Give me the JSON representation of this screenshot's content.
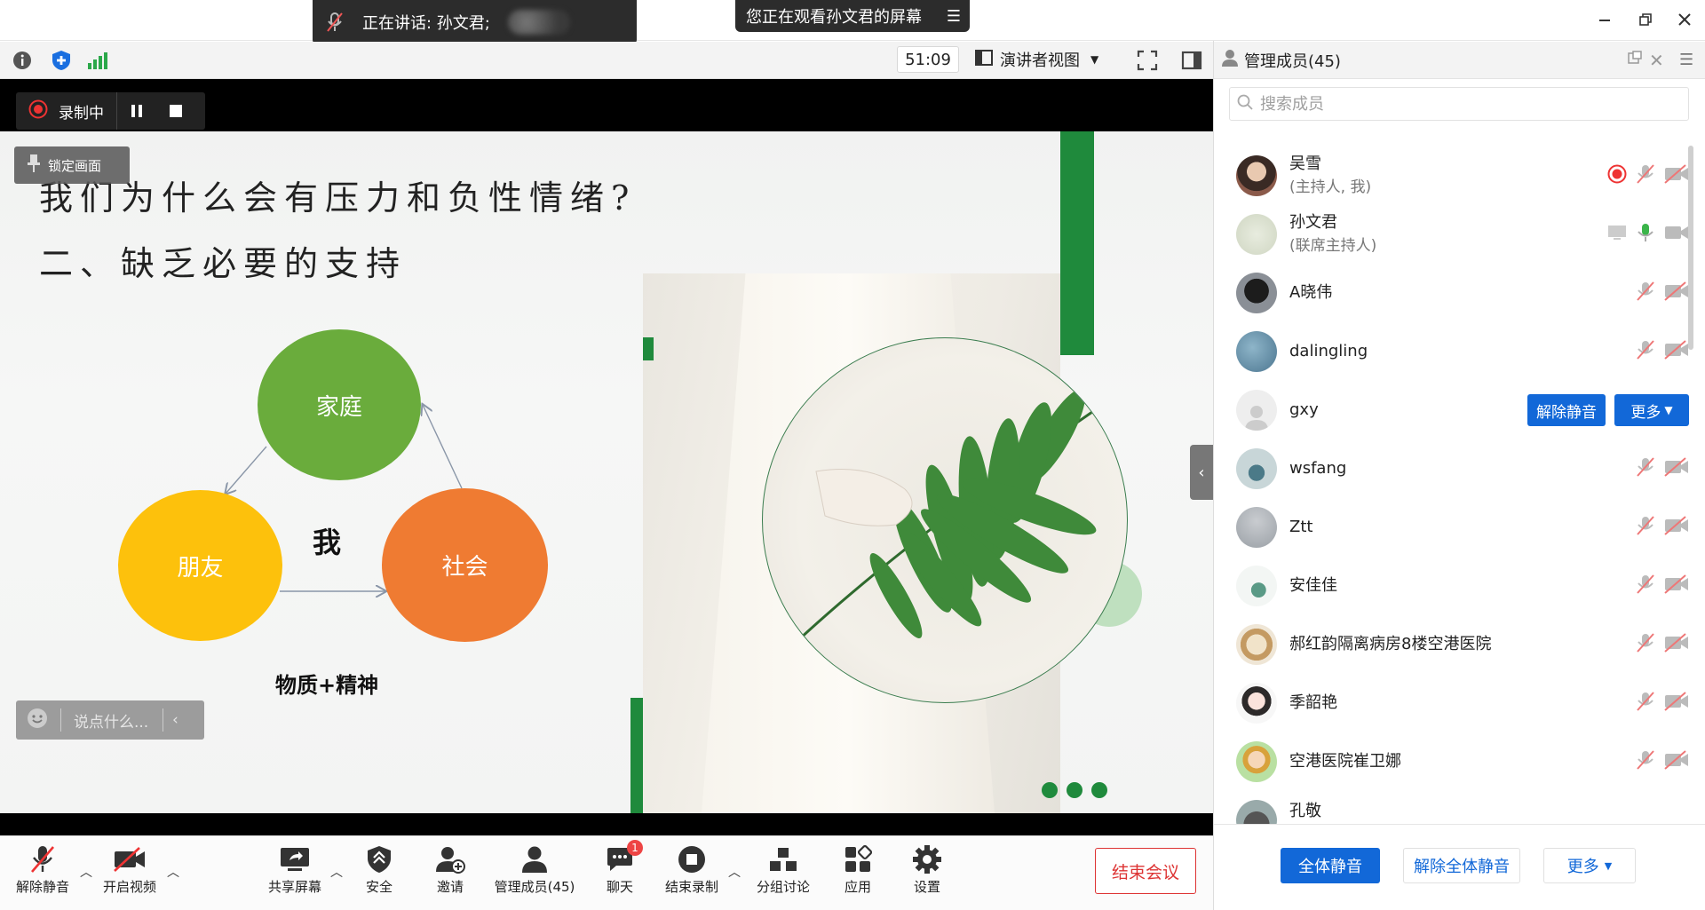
{
  "window": {
    "speaking_label": "正在讲话: 孙文君;",
    "watching_label": "您正在观看孙文君的屏幕"
  },
  "toolbar": {
    "timer": "51:09",
    "view_mode": "演讲者视图"
  },
  "recording": {
    "label": "录制中"
  },
  "overlay": {
    "lock_label": "锁定画面",
    "chat_placeholder": "说点什么..."
  },
  "slide": {
    "title_line1": "我们为什么会有压力和负性情绪?",
    "title_line2": "二、缺乏必要的支持",
    "circle_family": "家庭",
    "circle_friends": "朋友",
    "circle_society": "社会",
    "center_label": "我",
    "bottom_label": "物质+精神"
  },
  "bottom_bar": {
    "unmute": "解除静音",
    "start_video": "开启视频",
    "share_screen": "共享屏幕",
    "security": "安全",
    "invite": "邀请",
    "manage_members": "管理成员(45)",
    "chat": "聊天",
    "chat_badge": "1",
    "end_recording": "结束录制",
    "breakout": "分组讨论",
    "apps": "应用",
    "settings": "设置",
    "end_meeting": "结束会议"
  },
  "panel": {
    "title": "管理成员(45)",
    "search_placeholder": "搜索成员",
    "members": [
      {
        "name": "吴雪",
        "role": "(主持人, 我)"
      },
      {
        "name": "孙文君",
        "role": "(联席主持人)"
      },
      {
        "name": "A晓伟",
        "role": ""
      },
      {
        "name": "dalingling",
        "role": ""
      },
      {
        "name": "gxy",
        "role": ""
      },
      {
        "name": "wsfang",
        "role": ""
      },
      {
        "name": "Ztt",
        "role": ""
      },
      {
        "name": "安佳佳",
        "role": ""
      },
      {
        "name": "郝红韵隔离病房8楼空港医院",
        "role": ""
      },
      {
        "name": "季韶艳",
        "role": ""
      },
      {
        "name": "空港医院崔卫娜",
        "role": ""
      },
      {
        "name": "孔敬",
        "role": ""
      }
    ],
    "unmute_member_btn": "解除静音",
    "more_member_btn": "更多",
    "mute_all": "全体静音",
    "unmute_all": "解除全体静音",
    "more": "更多"
  }
}
